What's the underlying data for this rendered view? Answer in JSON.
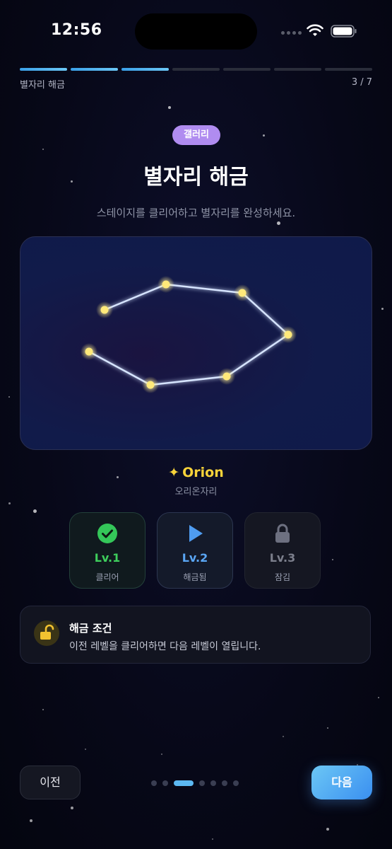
{
  "status": {
    "time": "12:56"
  },
  "progress": {
    "label": "별자리 해금",
    "count": "3 / 7",
    "current": 3,
    "total": 7
  },
  "header": {
    "badge": "갤러리",
    "title": "별자리 해금",
    "subtitle": "스테이지를 클리어하고 별자리를 완성하세요."
  },
  "constellation": {
    "name": "Orion",
    "spark": "✦",
    "korean_name": "오리온자리",
    "star_color": "#ffe97a",
    "line_color": "#d6e4ff"
  },
  "levels": [
    {
      "label": "Lv.1",
      "state": "클리어",
      "icon": "check-circle-icon",
      "color": "#3ecf5c"
    },
    {
      "label": "Lv.2",
      "state": "해금됨",
      "icon": "play-icon",
      "color": "#5aa6f5"
    },
    {
      "label": "Lv.3",
      "state": "잠김",
      "icon": "lock-icon",
      "color": "#7c7f8c"
    }
  ],
  "info": {
    "title": "해금 조건",
    "description": "이전 레벨을 클리어하면 다음 레벨이 열립니다.",
    "icon": "unlock-icon"
  },
  "nav": {
    "prev_label": "이전",
    "next_label": "다음",
    "page_index": 3,
    "page_total": 7
  }
}
